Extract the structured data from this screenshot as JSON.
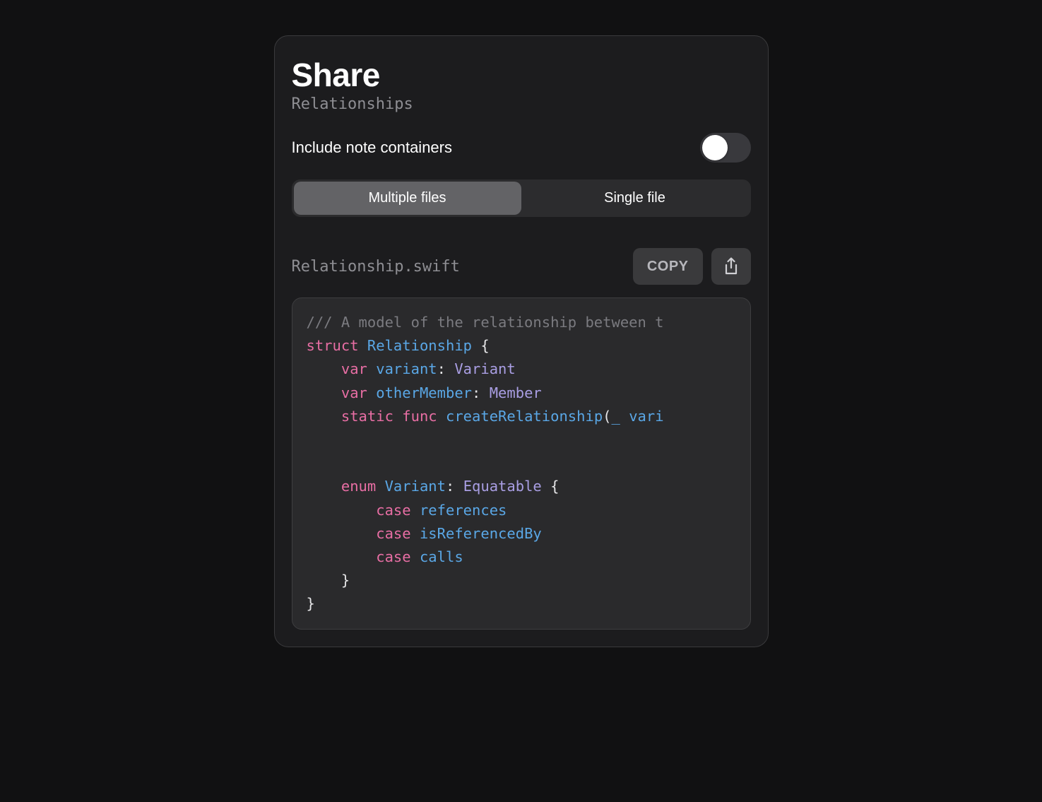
{
  "dialog": {
    "title": "Share",
    "subtitle": "Relationships",
    "includeNoteContainers": {
      "label": "Include note containers",
      "enabled": false
    },
    "segments": {
      "multiple": "Multiple files",
      "single": "Single file",
      "active": "multiple"
    },
    "file": {
      "name": "Relationship.swift",
      "copyLabel": "COPY"
    },
    "code": {
      "tokens": [
        [
          {
            "t": "comment",
            "v": "/// A model of the relationship between t"
          }
        ],
        [
          {
            "t": "keyword",
            "v": "struct"
          },
          {
            "t": "plain",
            "v": " "
          },
          {
            "t": "ident",
            "v": "Relationship"
          },
          {
            "t": "plain",
            "v": " {"
          }
        ],
        [
          {
            "t": "plain",
            "v": "    "
          },
          {
            "t": "keyword",
            "v": "var"
          },
          {
            "t": "plain",
            "v": " "
          },
          {
            "t": "ident",
            "v": "variant"
          },
          {
            "t": "plain",
            "v": ": "
          },
          {
            "t": "type",
            "v": "Variant"
          }
        ],
        [
          {
            "t": "plain",
            "v": "    "
          },
          {
            "t": "keyword",
            "v": "var"
          },
          {
            "t": "plain",
            "v": " "
          },
          {
            "t": "ident",
            "v": "otherMember"
          },
          {
            "t": "plain",
            "v": ": "
          },
          {
            "t": "type",
            "v": "Member"
          }
        ],
        [
          {
            "t": "plain",
            "v": "    "
          },
          {
            "t": "keyword",
            "v": "static"
          },
          {
            "t": "plain",
            "v": " "
          },
          {
            "t": "keyword",
            "v": "func"
          },
          {
            "t": "plain",
            "v": " "
          },
          {
            "t": "ident",
            "v": "createRelationship"
          },
          {
            "t": "plain",
            "v": "("
          },
          {
            "t": "param",
            "v": "_"
          },
          {
            "t": "plain",
            "v": " "
          },
          {
            "t": "param",
            "v": "vari"
          }
        ],
        [],
        [
          {
            "t": "plain",
            "v": "    "
          },
          {
            "t": "keyword",
            "v": "enum"
          },
          {
            "t": "plain",
            "v": " "
          },
          {
            "t": "ident",
            "v": "Variant"
          },
          {
            "t": "plain",
            "v": ": "
          },
          {
            "t": "type",
            "v": "Equatable"
          },
          {
            "t": "plain",
            "v": " {"
          }
        ],
        [
          {
            "t": "plain",
            "v": "        "
          },
          {
            "t": "keyword",
            "v": "case"
          },
          {
            "t": "plain",
            "v": " "
          },
          {
            "t": "ident",
            "v": "references"
          }
        ],
        [
          {
            "t": "plain",
            "v": "        "
          },
          {
            "t": "keyword",
            "v": "case"
          },
          {
            "t": "plain",
            "v": " "
          },
          {
            "t": "ident",
            "v": "isReferencedBy"
          }
        ],
        [
          {
            "t": "plain",
            "v": "        "
          },
          {
            "t": "keyword",
            "v": "case"
          },
          {
            "t": "plain",
            "v": " "
          },
          {
            "t": "ident",
            "v": "calls"
          }
        ],
        [
          {
            "t": "plain",
            "v": "    }"
          }
        ],
        [
          {
            "t": "plain",
            "v": "}"
          }
        ]
      ]
    }
  }
}
